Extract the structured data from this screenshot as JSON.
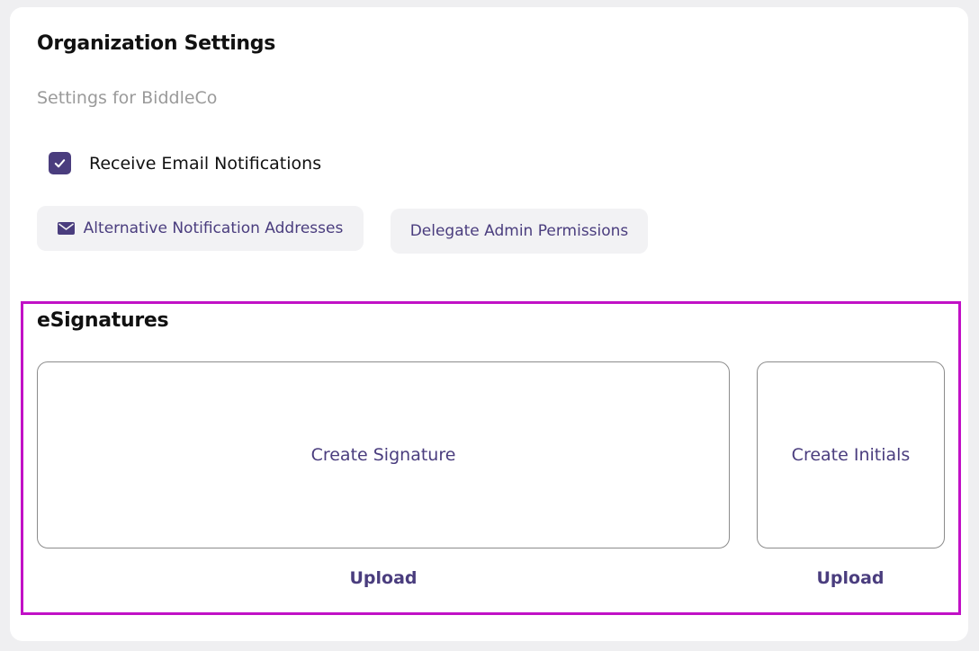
{
  "org_settings": {
    "title": "Organization Settings",
    "subtitle": "Settings for BiddleCo",
    "email_notifications": {
      "label": "Receive Email Notifications",
      "checked": true
    },
    "buttons": {
      "alternative_addresses": "Alternative Notification Addresses",
      "delegate_admin": "Delegate Admin Permissions"
    }
  },
  "esignatures": {
    "title": "eSignatures",
    "signature": {
      "create_label": "Create Signature",
      "upload_label": "Upload"
    },
    "initials": {
      "create_label": "Create Initials",
      "upload_label": "Upload"
    }
  },
  "icons": {
    "checkbox": "check-icon",
    "mail": "envelope-icon"
  },
  "colors": {
    "accent": "#4a3d7e",
    "highlight_border": "#c111c6",
    "muted_text": "#9a9a9a",
    "button_bg": "#f2f2f4"
  }
}
